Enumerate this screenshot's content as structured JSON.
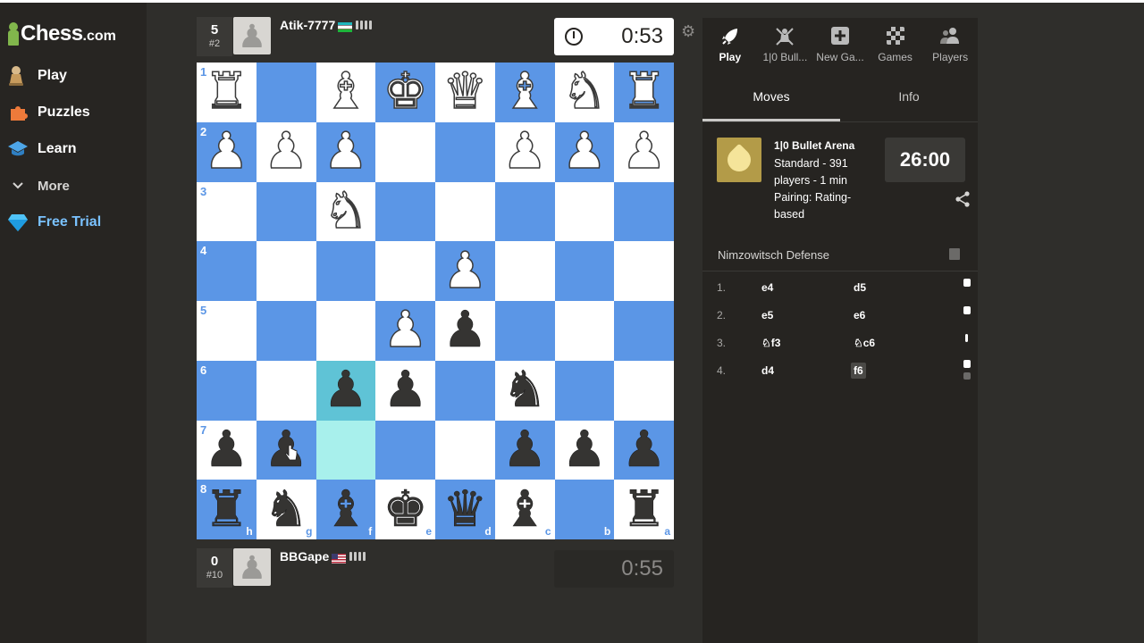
{
  "brand": {
    "name": "Chess",
    "suffix": ".com"
  },
  "nav": {
    "play": "Play",
    "puzzles": "Puzzles",
    "learn": "Learn",
    "more": "More",
    "trial": "Free Trial"
  },
  "top_player": {
    "score": "5",
    "rank": "#2",
    "name": "Atik-7777",
    "flag": "uzbekistan-flag",
    "clock": "0:53"
  },
  "bottom_player": {
    "score": "0",
    "rank": "#10",
    "name": "BBGape",
    "flag": "usa-flag",
    "clock": "0:55"
  },
  "board": {
    "orientation": "black-bottom",
    "rank_labels": [
      "1",
      "2",
      "3",
      "4",
      "5",
      "6",
      "7",
      "8"
    ],
    "file_labels": [
      "h",
      "g",
      "f",
      "e",
      "d",
      "c",
      "b",
      "a"
    ],
    "highlight_squares": [
      "f6",
      "f7"
    ],
    "position": [
      [
        "R",
        "",
        "B",
        "K",
        "Q",
        "B",
        "N",
        "R"
      ],
      [
        "P",
        "P",
        "P",
        "",
        "",
        "P",
        "P",
        "P"
      ],
      [
        "",
        "",
        "N",
        "",
        "",
        "",
        "",
        ""
      ],
      [
        "",
        "",
        "",
        "",
        "P",
        "",
        "",
        ""
      ],
      [
        "",
        "",
        "",
        "P",
        "p",
        "",
        "",
        ""
      ],
      [
        "",
        "",
        "p",
        "p",
        "",
        "n",
        "",
        ""
      ],
      [
        "p",
        "p",
        "",
        "",
        "",
        "p",
        "p",
        "p"
      ],
      [
        "r",
        "n",
        "b",
        "k",
        "q",
        "b",
        "",
        "r"
      ]
    ]
  },
  "panel": {
    "tabs": [
      {
        "label": "Play",
        "icon": "rocket-icon"
      },
      {
        "label": "1|0 Bull...",
        "icon": "tournament-icon"
      },
      {
        "label": "New Ga...",
        "icon": "plus-icon"
      },
      {
        "label": "Games",
        "icon": "board-icon"
      },
      {
        "label": "Players",
        "icon": "players-icon"
      }
    ],
    "subtabs": [
      "Moves",
      "Info"
    ],
    "event": {
      "name": "1|0 Bullet Arena",
      "description": "Standard - 391 players - 1 min Pairing: Rating-based",
      "timer": "26:00"
    },
    "opening": "Nimzowitsch Defense",
    "moves": [
      {
        "num": "1.",
        "white": "e4",
        "black": "d5"
      },
      {
        "num": "2.",
        "white": "e5",
        "black": "e6"
      },
      {
        "num": "3.",
        "white": "♘f3",
        "black": "♘c6"
      },
      {
        "num": "4.",
        "white": "d4",
        "black": "f6"
      }
    ]
  },
  "colors": {
    "light_square": "#ffffff",
    "dark_square": "#5b96e6",
    "highlight": "#a8f0ec",
    "accent_green": "#81b64c",
    "trial_blue": "#7ac2ff"
  }
}
